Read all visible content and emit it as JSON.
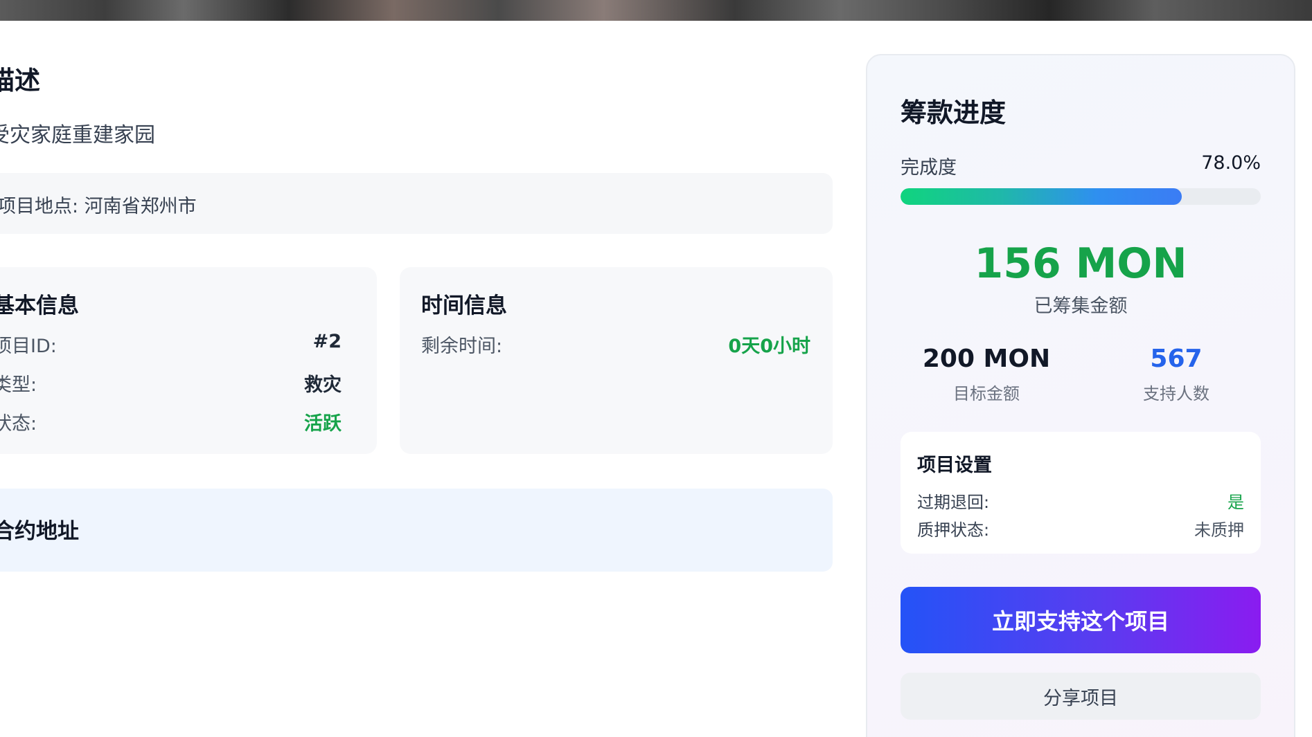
{
  "project": {
    "description_title": "描述",
    "description_text": "受灾家庭重建家园",
    "location": "项目地点: 河南省郑州市"
  },
  "basic_info": {
    "title": "基本信息",
    "rows": [
      {
        "label": "项目ID:",
        "value": "#2"
      },
      {
        "label": "类型:",
        "value": "救灾"
      },
      {
        "label": "状态:",
        "value": "活跃"
      }
    ]
  },
  "time_info": {
    "title": "时间信息",
    "remaining_label": "剩余时间:",
    "remaining_value": "0天0小时"
  },
  "contract": {
    "title": "合约地址"
  },
  "funding": {
    "title": "筹款进度",
    "progress_label": "完成度",
    "progress_text": "78.0%",
    "progress_fraction": 0.78,
    "raised_amount": "156 MON",
    "raised_label": "已筹集金额",
    "goal_amount": "200 MON",
    "goal_label": "目标金额",
    "backers_count": "567",
    "backers_label": "支持人数"
  },
  "settings": {
    "title": "项目设置",
    "refund_label": "过期退回:",
    "refund_value": "是",
    "pledge_label": "质押状态:",
    "pledge_value": "未质押"
  },
  "actions": {
    "support_label": "立即支持这个项目",
    "share_label": "分享项目"
  },
  "colors": {
    "success": "#16a34a",
    "accent_blue": "#2563eb",
    "button_gradient_start": "#2453f7",
    "button_gradient_end": "#8a1cf0"
  }
}
